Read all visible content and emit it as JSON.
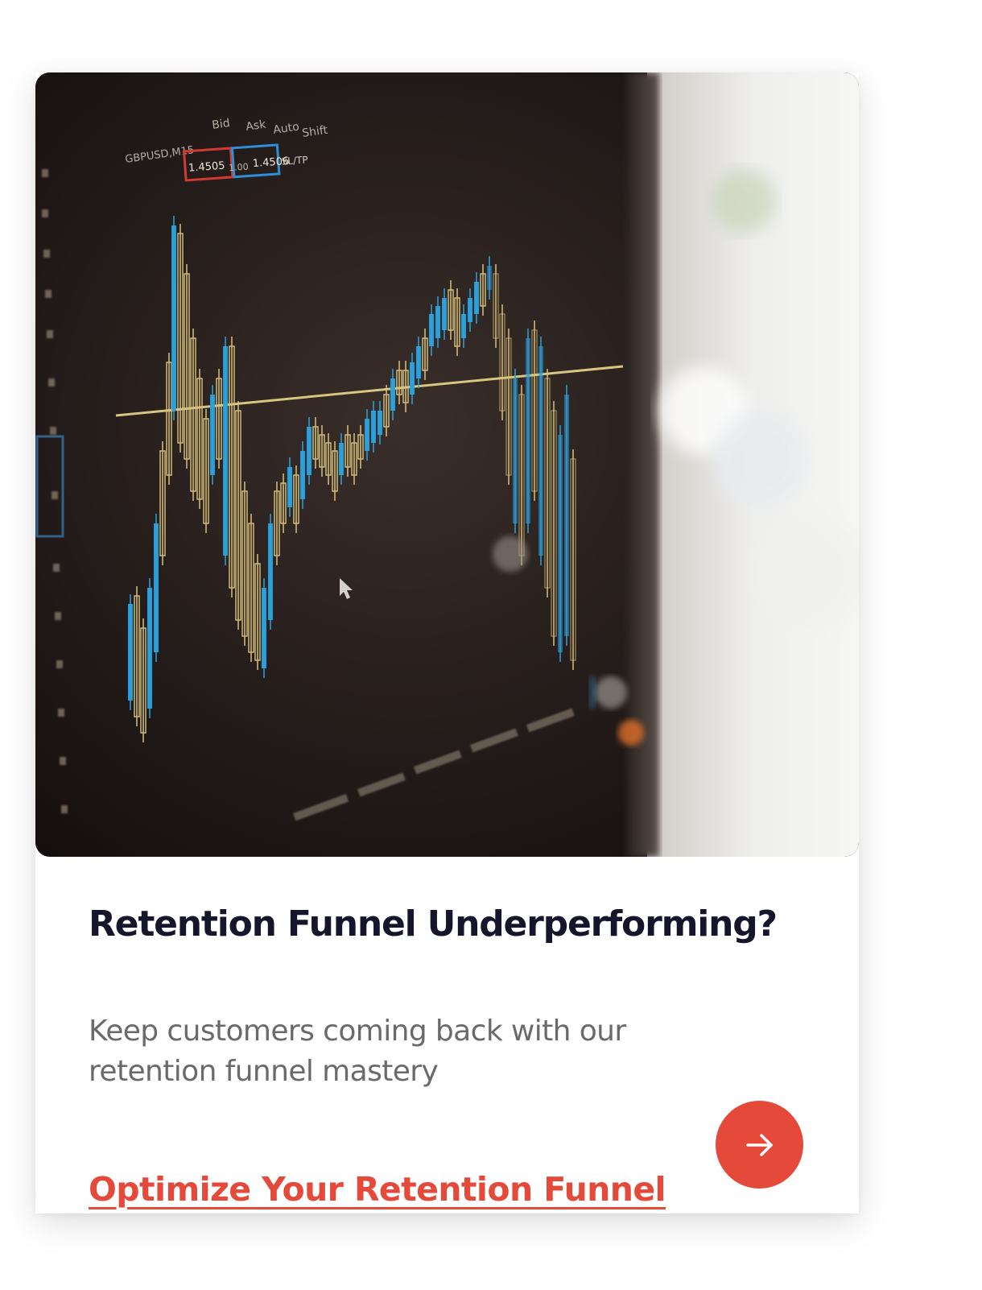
{
  "card": {
    "image_alt": "Trading chart on a monitor",
    "title": "Retention Funnel Underperforming?",
    "description": "Keep customers coming back with our retention funnel mastery",
    "cta_label": "Optimize Your Retention Funnel",
    "cta_icon": "arrow-right-icon"
  },
  "photo_screen_text": {
    "pair": "GBPUSD,M15",
    "price_bid": "1.4505",
    "lot": "1.00",
    "price_ask": "1.4506",
    "sltp": "SL/TP",
    "bid_label": "Bid",
    "ask_label": "Ask",
    "auto_label": "Auto",
    "shift_label": "Shift"
  },
  "colors": {
    "title": "#15152b",
    "description": "#6a6a6a",
    "accent": "#e5493a",
    "candle_blue": "#29a3e0",
    "candle_yellow": "#d8c27a"
  }
}
